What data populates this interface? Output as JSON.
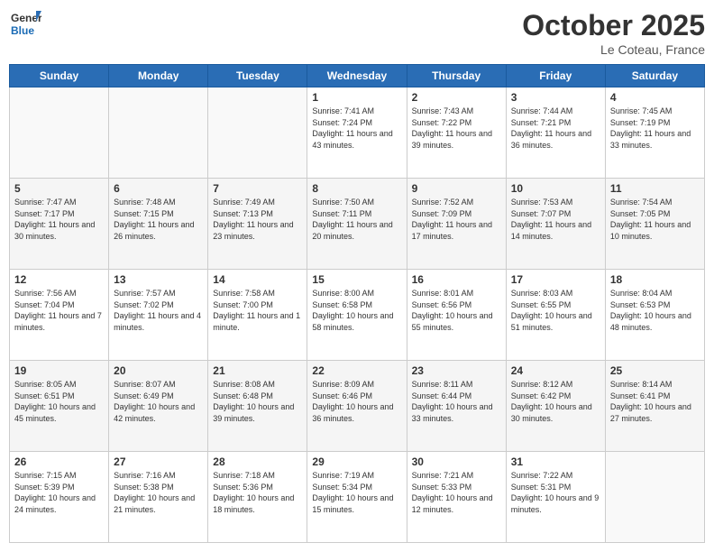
{
  "logo": {
    "general": "General",
    "blue": "Blue"
  },
  "header": {
    "month": "October 2025",
    "location": "Le Coteau, France"
  },
  "weekdays": [
    "Sunday",
    "Monday",
    "Tuesday",
    "Wednesday",
    "Thursday",
    "Friday",
    "Saturday"
  ],
  "weeks": [
    [
      {
        "day": "",
        "sunrise": "",
        "sunset": "",
        "daylight": ""
      },
      {
        "day": "",
        "sunrise": "",
        "sunset": "",
        "daylight": ""
      },
      {
        "day": "",
        "sunrise": "",
        "sunset": "",
        "daylight": ""
      },
      {
        "day": "1",
        "sunrise": "Sunrise: 7:41 AM",
        "sunset": "Sunset: 7:24 PM",
        "daylight": "Daylight: 11 hours and 43 minutes."
      },
      {
        "day": "2",
        "sunrise": "Sunrise: 7:43 AM",
        "sunset": "Sunset: 7:22 PM",
        "daylight": "Daylight: 11 hours and 39 minutes."
      },
      {
        "day": "3",
        "sunrise": "Sunrise: 7:44 AM",
        "sunset": "Sunset: 7:21 PM",
        "daylight": "Daylight: 11 hours and 36 minutes."
      },
      {
        "day": "4",
        "sunrise": "Sunrise: 7:45 AM",
        "sunset": "Sunset: 7:19 PM",
        "daylight": "Daylight: 11 hours and 33 minutes."
      }
    ],
    [
      {
        "day": "5",
        "sunrise": "Sunrise: 7:47 AM",
        "sunset": "Sunset: 7:17 PM",
        "daylight": "Daylight: 11 hours and 30 minutes."
      },
      {
        "day": "6",
        "sunrise": "Sunrise: 7:48 AM",
        "sunset": "Sunset: 7:15 PM",
        "daylight": "Daylight: 11 hours and 26 minutes."
      },
      {
        "day": "7",
        "sunrise": "Sunrise: 7:49 AM",
        "sunset": "Sunset: 7:13 PM",
        "daylight": "Daylight: 11 hours and 23 minutes."
      },
      {
        "day": "8",
        "sunrise": "Sunrise: 7:50 AM",
        "sunset": "Sunset: 7:11 PM",
        "daylight": "Daylight: 11 hours and 20 minutes."
      },
      {
        "day": "9",
        "sunrise": "Sunrise: 7:52 AM",
        "sunset": "Sunset: 7:09 PM",
        "daylight": "Daylight: 11 hours and 17 minutes."
      },
      {
        "day": "10",
        "sunrise": "Sunrise: 7:53 AM",
        "sunset": "Sunset: 7:07 PM",
        "daylight": "Daylight: 11 hours and 14 minutes."
      },
      {
        "day": "11",
        "sunrise": "Sunrise: 7:54 AM",
        "sunset": "Sunset: 7:05 PM",
        "daylight": "Daylight: 11 hours and 10 minutes."
      }
    ],
    [
      {
        "day": "12",
        "sunrise": "Sunrise: 7:56 AM",
        "sunset": "Sunset: 7:04 PM",
        "daylight": "Daylight: 11 hours and 7 minutes."
      },
      {
        "day": "13",
        "sunrise": "Sunrise: 7:57 AM",
        "sunset": "Sunset: 7:02 PM",
        "daylight": "Daylight: 11 hours and 4 minutes."
      },
      {
        "day": "14",
        "sunrise": "Sunrise: 7:58 AM",
        "sunset": "Sunset: 7:00 PM",
        "daylight": "Daylight: 11 hours and 1 minute."
      },
      {
        "day": "15",
        "sunrise": "Sunrise: 8:00 AM",
        "sunset": "Sunset: 6:58 PM",
        "daylight": "Daylight: 10 hours and 58 minutes."
      },
      {
        "day": "16",
        "sunrise": "Sunrise: 8:01 AM",
        "sunset": "Sunset: 6:56 PM",
        "daylight": "Daylight: 10 hours and 55 minutes."
      },
      {
        "day": "17",
        "sunrise": "Sunrise: 8:03 AM",
        "sunset": "Sunset: 6:55 PM",
        "daylight": "Daylight: 10 hours and 51 minutes."
      },
      {
        "day": "18",
        "sunrise": "Sunrise: 8:04 AM",
        "sunset": "Sunset: 6:53 PM",
        "daylight": "Daylight: 10 hours and 48 minutes."
      }
    ],
    [
      {
        "day": "19",
        "sunrise": "Sunrise: 8:05 AM",
        "sunset": "Sunset: 6:51 PM",
        "daylight": "Daylight: 10 hours and 45 minutes."
      },
      {
        "day": "20",
        "sunrise": "Sunrise: 8:07 AM",
        "sunset": "Sunset: 6:49 PM",
        "daylight": "Daylight: 10 hours and 42 minutes."
      },
      {
        "day": "21",
        "sunrise": "Sunrise: 8:08 AM",
        "sunset": "Sunset: 6:48 PM",
        "daylight": "Daylight: 10 hours and 39 minutes."
      },
      {
        "day": "22",
        "sunrise": "Sunrise: 8:09 AM",
        "sunset": "Sunset: 6:46 PM",
        "daylight": "Daylight: 10 hours and 36 minutes."
      },
      {
        "day": "23",
        "sunrise": "Sunrise: 8:11 AM",
        "sunset": "Sunset: 6:44 PM",
        "daylight": "Daylight: 10 hours and 33 minutes."
      },
      {
        "day": "24",
        "sunrise": "Sunrise: 8:12 AM",
        "sunset": "Sunset: 6:42 PM",
        "daylight": "Daylight: 10 hours and 30 minutes."
      },
      {
        "day": "25",
        "sunrise": "Sunrise: 8:14 AM",
        "sunset": "Sunset: 6:41 PM",
        "daylight": "Daylight: 10 hours and 27 minutes."
      }
    ],
    [
      {
        "day": "26",
        "sunrise": "Sunrise: 7:15 AM",
        "sunset": "Sunset: 5:39 PM",
        "daylight": "Daylight: 10 hours and 24 minutes."
      },
      {
        "day": "27",
        "sunrise": "Sunrise: 7:16 AM",
        "sunset": "Sunset: 5:38 PM",
        "daylight": "Daylight: 10 hours and 21 minutes."
      },
      {
        "day": "28",
        "sunrise": "Sunrise: 7:18 AM",
        "sunset": "Sunset: 5:36 PM",
        "daylight": "Daylight: 10 hours and 18 minutes."
      },
      {
        "day": "29",
        "sunrise": "Sunrise: 7:19 AM",
        "sunset": "Sunset: 5:34 PM",
        "daylight": "Daylight: 10 hours and 15 minutes."
      },
      {
        "day": "30",
        "sunrise": "Sunrise: 7:21 AM",
        "sunset": "Sunset: 5:33 PM",
        "daylight": "Daylight: 10 hours and 12 minutes."
      },
      {
        "day": "31",
        "sunrise": "Sunrise: 7:22 AM",
        "sunset": "Sunset: 5:31 PM",
        "daylight": "Daylight: 10 hours and 9 minutes."
      },
      {
        "day": "",
        "sunrise": "",
        "sunset": "",
        "daylight": ""
      }
    ]
  ]
}
